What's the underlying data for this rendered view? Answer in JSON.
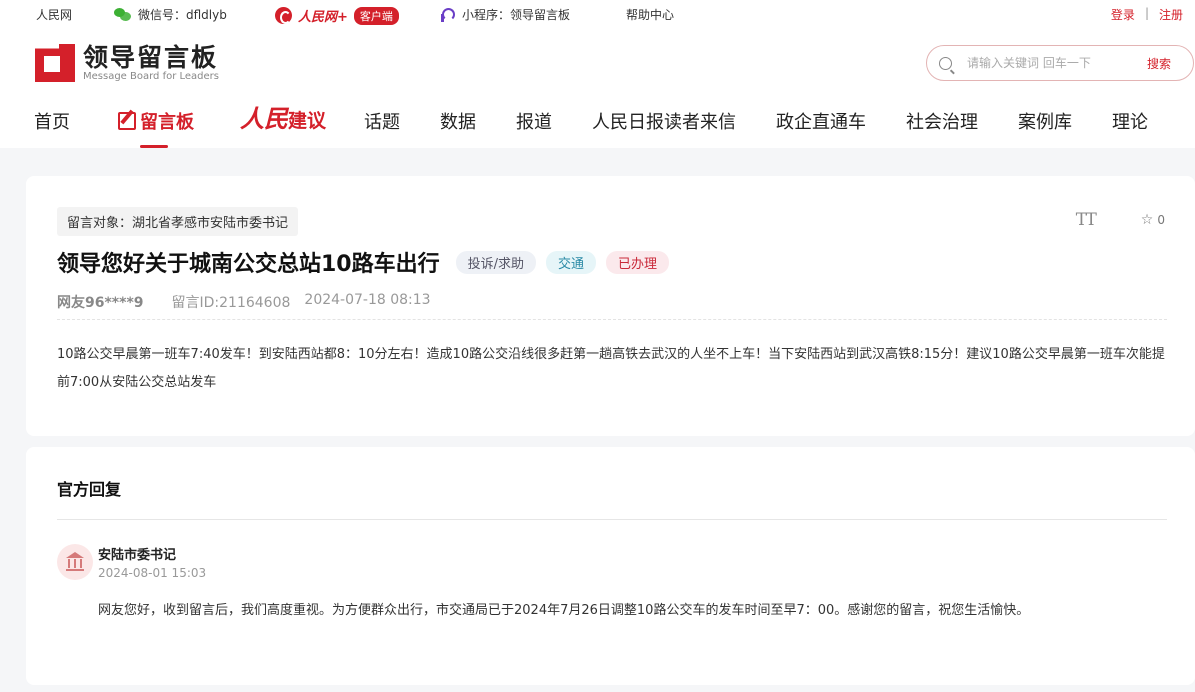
{
  "topbar": {
    "site": "人民网",
    "wechat": "微信号：dfldlyb",
    "app_brand": "人民网+",
    "app_badge": "客户端",
    "miniprogram": "小程序：领导留言板",
    "help": "帮助中心",
    "login": "登录",
    "separator": "|",
    "register": "注册"
  },
  "logo": {
    "cn": "领导留言板",
    "en": "Message Board for Leaders"
  },
  "search": {
    "placeholder": "请输入关键词 回车一下",
    "button": "搜索"
  },
  "nav": {
    "home": "首页",
    "board": "留言板",
    "jianyi_ren": "人民",
    "jianyi": "建议",
    "topics": "话题",
    "data": "数据",
    "reports": "报道",
    "letters": "人民日报读者来信",
    "enterprise": "政企直通车",
    "governance": "社会治理",
    "cases": "案例库",
    "theory": "理论"
  },
  "message": {
    "target": "留言对象：湖北省孝感市安陆市委书记",
    "font_toggle": "TT",
    "star_count": "0",
    "title": "领导您好关于城南公交总站10路车出行",
    "tags": [
      "投诉/求助",
      "交通",
      "已办理"
    ],
    "user": "网友96****9",
    "id": "留言ID:21164608",
    "time": "2024-07-18 08:13",
    "content": "10路公交早晨第一班车7:40发车！到安陆西站都8：10分左右！造成10路公交沿线很多赶第一趟高铁去武汉的人坐不上车！当下安陆西站到武汉高铁8:15分！建议10路公交早晨第一班车次能提前7:00从安陆公交总站发车"
  },
  "reply": {
    "heading": "官方回复",
    "name": "安陆市委书记",
    "time": "2024-08-01 15:03",
    "body": "网友您好，收到留言后，我们高度重视。为方便群众出行，市交通局已于2024年7月26日调整10路公交车的发车时间至早7：00。感谢您的留言，祝您生活愉快。"
  },
  "colors": {
    "brand_red": "#d4202a",
    "tag_traffic": "#2b8aa6",
    "tag_done": "#c92a3a"
  }
}
